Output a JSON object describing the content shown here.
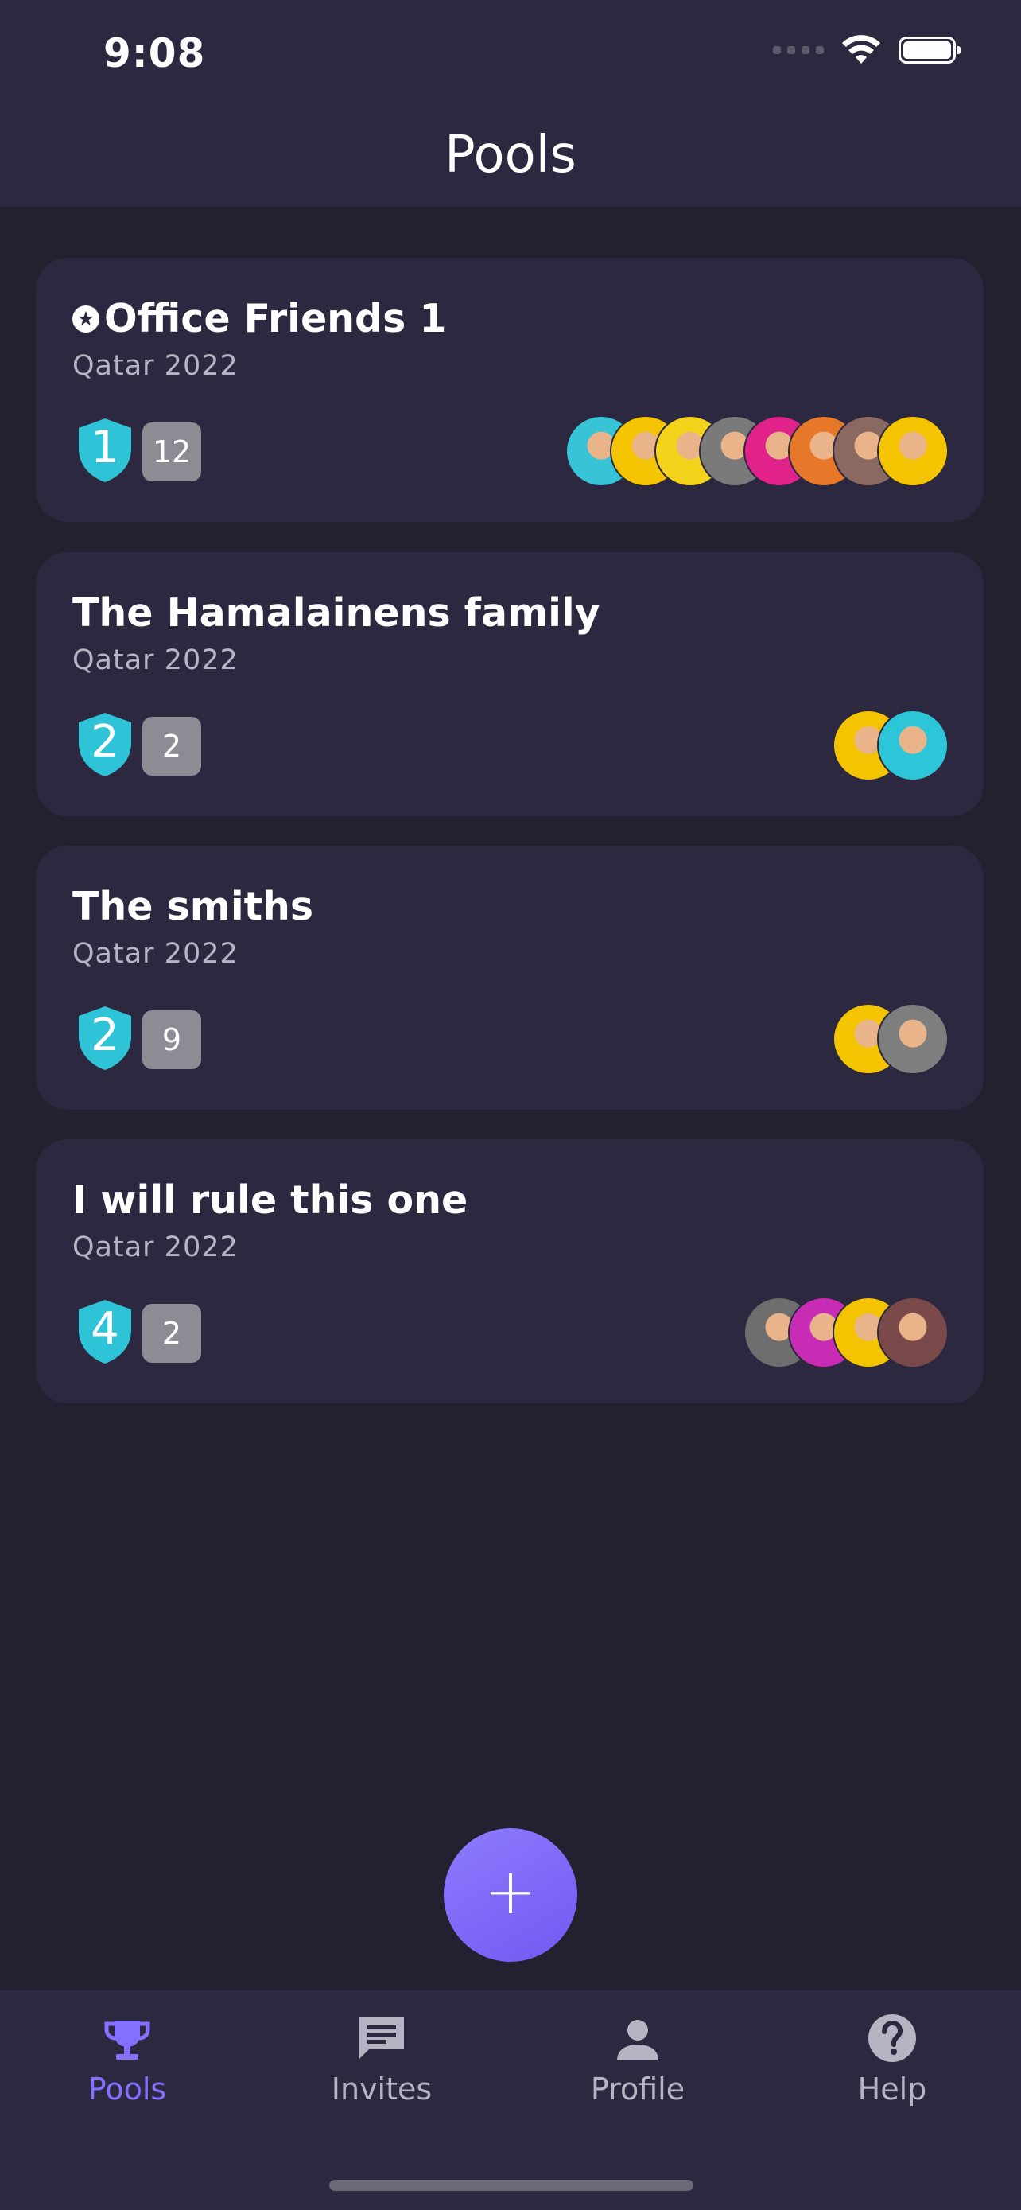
{
  "status_bar": {
    "time": "9:08"
  },
  "header": {
    "title": "Pools"
  },
  "pools": [
    {
      "name": "Office Friends 1",
      "owned_by_user": true,
      "subtitle": "Qatar 2022",
      "rank": "1",
      "member_count": "12",
      "avatar_colors": [
        "#36c4d6",
        "#f5c400",
        "#f3d41a",
        "#7a7a7a",
        "#e0228a",
        "#e7782a",
        "#8a6a60",
        "#f5c400"
      ]
    },
    {
      "name": "The Hamalainens family",
      "owned_by_user": false,
      "subtitle": "Qatar 2022",
      "rank": "2",
      "member_count": "2",
      "avatar_colors": [
        "#f5c400",
        "#2dc6d8"
      ]
    },
    {
      "name": "The smiths",
      "owned_by_user": false,
      "subtitle": "Qatar 2022",
      "rank": "2",
      "member_count": "9",
      "avatar_colors": [
        "#f5c400",
        "#7e7e7e"
      ]
    },
    {
      "name": "I will rule this one",
      "owned_by_user": false,
      "subtitle": "Qatar 2022",
      "rank": "4",
      "member_count": "2",
      "avatar_colors": [
        "#6e6e6e",
        "#c82cb5",
        "#f5c400",
        "#7a4a4a"
      ]
    }
  ],
  "fab": {
    "label": "+"
  },
  "tabs": [
    {
      "label": "Pools",
      "icon": "trophy-icon",
      "active": true
    },
    {
      "label": "Invites",
      "icon": "chat-icon",
      "active": false
    },
    {
      "label": "Profile",
      "icon": "person-icon",
      "active": false
    },
    {
      "label": "Help",
      "icon": "help-icon",
      "active": false
    }
  ],
  "colors": {
    "background": "#23212f",
    "surface": "#2b2840",
    "accent": "#8470ff",
    "shield": "#2ec3d6",
    "badge": "#8d8c94",
    "inactive_tab": "#b6b4c2"
  }
}
